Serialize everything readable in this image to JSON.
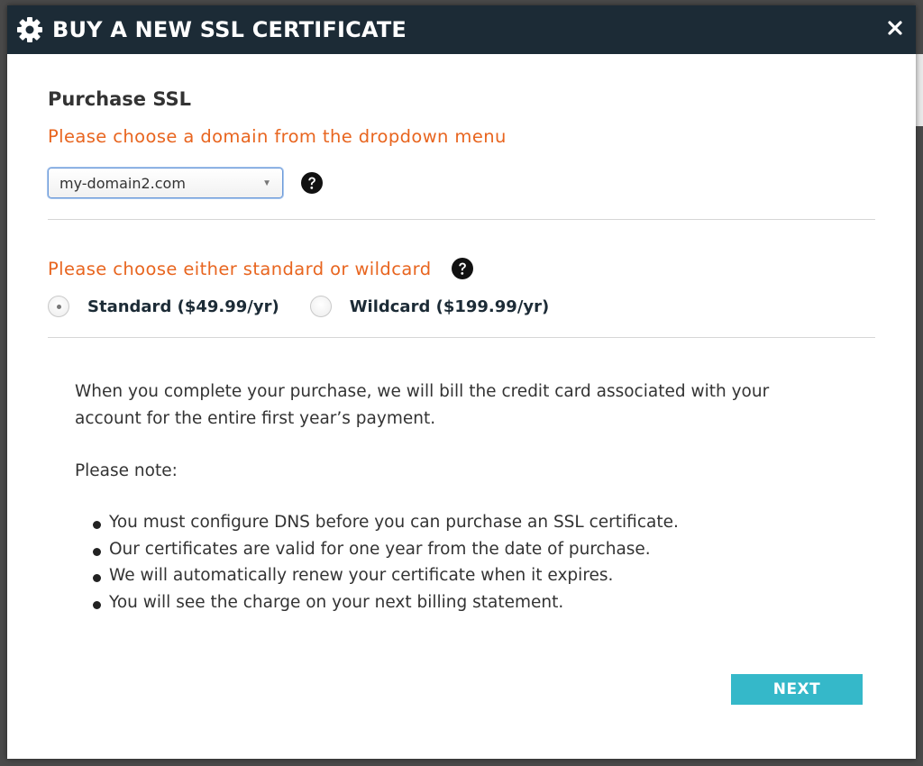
{
  "modal": {
    "title": "BUY A NEW SSL CERTIFICATE"
  },
  "purchase": {
    "section_title": "Purchase SSL",
    "domain_prompt": "Please choose a domain from the dropdown menu",
    "domain_select": {
      "selected": "my-domain2.com"
    },
    "type_prompt": "Please choose either standard or wildcard",
    "options": [
      {
        "label": "Standard ($49.99/yr)",
        "checked": true
      },
      {
        "label": "Wildcard ($199.99/yr)",
        "checked": false
      }
    ]
  },
  "info": {
    "billing_text": "When you complete your purchase, we will bill the credit card associated with your account for the entire first year’s payment.",
    "note_label": "Please note:",
    "bullets": [
      "You must configure DNS before you can purchase an SSL certificate.",
      "Our certificates are valid for one year from the date of purchase.",
      "We will automatically renew your certificate when it expires.",
      "You will see the charge on your next billing statement."
    ]
  },
  "actions": {
    "next_label": "NEXT"
  },
  "colors": {
    "header_bg": "#1c2b36",
    "accent_orange": "#e8651f",
    "button_teal": "#35b8c9"
  },
  "icons": {
    "header": "gear-icon",
    "close": "close-icon",
    "help": "help-icon"
  }
}
